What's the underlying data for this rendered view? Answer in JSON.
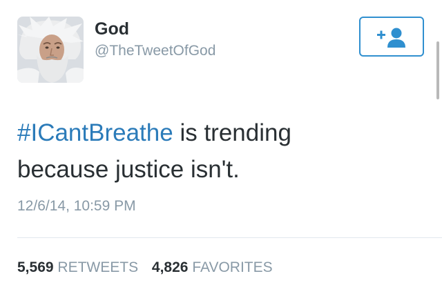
{
  "user": {
    "display_name": "God",
    "handle": "@TheTweetOfGod",
    "avatar_icon": "bearded-man-portrait"
  },
  "follow_button": {
    "icon": "add-user-icon",
    "color": "#2f8fcf"
  },
  "tweet": {
    "hashtag": "#ICantBreathe",
    "text_line1_rest": " is trending",
    "text_line2": "because justice isn't.",
    "timestamp": "12/6/14, 10:59 PM",
    "hashtag_color": "#2b7bb9"
  },
  "stats": {
    "retweets_count": "5,569",
    "retweets_label": "RETWEETS",
    "favorites_count": "4,826",
    "favorites_label": "FAVORITES"
  }
}
